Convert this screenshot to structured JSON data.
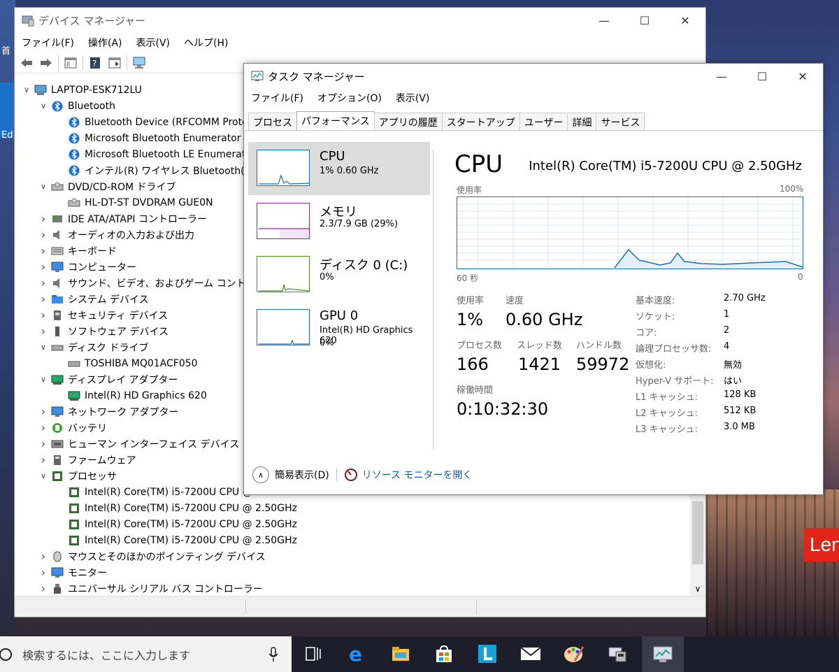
{
  "desktop": {
    "left_char_1": "首",
    "left_char_2": "Ed",
    "brand": "Len"
  },
  "device_manager": {
    "title": "デバイス マネージャー",
    "menu": [
      "ファイル(F)",
      "操作(A)",
      "表示(V)",
      "ヘルプ(H)"
    ],
    "tree": [
      {
        "label": "LAPTOP-ESK712LU",
        "level": 0,
        "arrow": "v",
        "icon": "computer-icon"
      },
      {
        "label": "Bluetooth",
        "level": 1,
        "arrow": "v",
        "icon": "bluetooth-icon"
      },
      {
        "label": "Bluetooth Device (RFCOMM Proto",
        "level": 2,
        "arrow": "",
        "icon": "bluetooth-icon"
      },
      {
        "label": "Microsoft Bluetooth Enumerator",
        "level": 2,
        "arrow": "",
        "icon": "bluetooth-icon"
      },
      {
        "label": "Microsoft Bluetooth LE Enumerat",
        "level": 2,
        "arrow": "",
        "icon": "bluetooth-icon"
      },
      {
        "label": "インテル(R) ワイヤレス Bluetooth(R)",
        "level": 2,
        "arrow": "",
        "icon": "bluetooth-icon"
      },
      {
        "label": "DVD/CD-ROM ドライブ",
        "level": 1,
        "arrow": "v",
        "icon": "dvd-drive-icon"
      },
      {
        "label": "HL-DT-ST DVDRAM GUE0N",
        "level": 2,
        "arrow": "",
        "icon": "dvd-drive-icon"
      },
      {
        "label": "IDE ATA/ATAPI コントローラー",
        "level": 1,
        "arrow": ">",
        "icon": "ide-controller-icon"
      },
      {
        "label": "オーディオの入力および出力",
        "level": 1,
        "arrow": ">",
        "icon": "speaker-icon"
      },
      {
        "label": "キーボード",
        "level": 1,
        "arrow": ">",
        "icon": "keyboard-icon"
      },
      {
        "label": "コンピューター",
        "level": 1,
        "arrow": ">",
        "icon": "monitor-icon"
      },
      {
        "label": "サウンド、ビデオ、およびゲーム コントローラー",
        "level": 1,
        "arrow": ">",
        "icon": "speaker-icon"
      },
      {
        "label": "システム デバイス",
        "level": 1,
        "arrow": ">",
        "icon": "folder-icon"
      },
      {
        "label": "セキュリティ デバイス",
        "level": 1,
        "arrow": ">",
        "icon": "security-device-icon"
      },
      {
        "label": "ソフトウェア デバイス",
        "level": 1,
        "arrow": ">",
        "icon": "software-device-icon"
      },
      {
        "label": "ディスク ドライブ",
        "level": 1,
        "arrow": "v",
        "icon": "disk-drive-icon"
      },
      {
        "label": "TOSHIBA MQ01ACF050",
        "level": 2,
        "arrow": "",
        "icon": "disk-drive-icon"
      },
      {
        "label": "ディスプレイ アダプター",
        "level": 1,
        "arrow": "v",
        "icon": "display-adapter-icon"
      },
      {
        "label": "Intel(R) HD Graphics 620",
        "level": 2,
        "arrow": "",
        "icon": "display-adapter-icon"
      },
      {
        "label": "ネットワーク アダプター",
        "level": 1,
        "arrow": ">",
        "icon": "monitor-icon"
      },
      {
        "label": "バッテリ",
        "level": 1,
        "arrow": ">",
        "icon": "battery-icon"
      },
      {
        "label": "ヒューマン インターフェイス デバイス",
        "level": 1,
        "arrow": ">",
        "icon": "hid-icon"
      },
      {
        "label": "ファームウェア",
        "level": 1,
        "arrow": ">",
        "icon": "firmware-icon"
      },
      {
        "label": "プロセッサ",
        "level": 1,
        "arrow": "v",
        "icon": "processor-icon"
      },
      {
        "label": "Intel(R) Core(TM) i5-7200U CPU @",
        "level": 2,
        "arrow": "",
        "icon": "processor-icon"
      },
      {
        "label": "Intel(R) Core(TM) i5-7200U CPU @ 2.50GHz",
        "level": 2,
        "arrow": "",
        "icon": "processor-icon"
      },
      {
        "label": "Intel(R) Core(TM) i5-7200U CPU @ 2.50GHz",
        "level": 2,
        "arrow": "",
        "icon": "processor-icon"
      },
      {
        "label": "Intel(R) Core(TM) i5-7200U CPU @ 2.50GHz",
        "level": 2,
        "arrow": "",
        "icon": "processor-icon"
      },
      {
        "label": "マウスとそのほかのポインティング デバイス",
        "level": 1,
        "arrow": ">",
        "icon": "mouse-icon"
      },
      {
        "label": "モニター",
        "level": 1,
        "arrow": ">",
        "icon": "monitor-icon"
      },
      {
        "label": "ユニバーサル シリアル バス コントローラー",
        "level": 1,
        "arrow": ">",
        "icon": "usb-icon"
      }
    ]
  },
  "task_manager": {
    "title": "タスク マネージャー",
    "menu": [
      "ファイル(F)",
      "オプション(O)",
      "表示(V)"
    ],
    "tabs": [
      "プロセス",
      "パフォーマンス",
      "アプリの履歴",
      "スタートアップ",
      "ユーザー",
      "詳細",
      "サービス"
    ],
    "active_tab": 1,
    "sidebar": [
      {
        "name": "CPU",
        "sub": "1%  0.60 GHz",
        "sub2": "",
        "color": "#1a6fb4"
      },
      {
        "name": "メモリ",
        "sub": "2.3/7.9 GB (29%)",
        "sub2": "",
        "color": "#8b2a9b"
      },
      {
        "name": "ディスク 0 (C:)",
        "sub": "0%",
        "sub2": "",
        "color": "#4d8c1f"
      },
      {
        "name": "GPU 0",
        "sub": "Intel(R) HD Graphics 620",
        "sub2": "0%",
        "color": "#1a6fb4"
      }
    ],
    "cpu": {
      "heading": "CPU",
      "model": "Intel(R) Core(TM) i5-7200U CPU @ 2.50GHz",
      "graph_label": "使用率",
      "graph_max": "100%",
      "graph_time": "60 秒",
      "graph_zero": "0",
      "usage_label": "使用率",
      "usage_value": "1%",
      "speed_label": "速度",
      "speed_value": "0.60 GHz",
      "proc_label": "プロセス数",
      "proc_value": "166",
      "thread_label": "スレッド数",
      "thread_value": "1421",
      "handle_label": "ハンドル数",
      "handle_value": "59972",
      "uptime_label": "稼働時間",
      "uptime_value": "0:10:32:30",
      "details": [
        {
          "k": "基本速度:",
          "v": "2.70 GHz"
        },
        {
          "k": "ソケット:",
          "v": "1"
        },
        {
          "k": "コア:",
          "v": "2"
        },
        {
          "k": "論理プロセッサ数:",
          "v": "4"
        },
        {
          "k": "仮想化:",
          "v": "無効"
        },
        {
          "k": "Hyper-V サポート:",
          "v": "はい"
        },
        {
          "k": "L1 キャッシュ:",
          "v": "128 KB"
        },
        {
          "k": "L2 キャッシュ:",
          "v": "512 KB"
        },
        {
          "k": "L3 キャッシュ:",
          "v": "3.0 MB"
        }
      ]
    },
    "footer_simple": "簡易表示(D)",
    "footer_link": "リソース モニターを開く"
  },
  "taskbar": {
    "search_placeholder": "検索するには、ここに入力します",
    "apps": [
      "task-view-icon",
      "edge-icon",
      "file-explorer-icon",
      "store-icon",
      "lenovo-l-icon",
      "mail-icon",
      "paint-icon",
      "device-manager-icon",
      "task-manager-icon"
    ]
  }
}
